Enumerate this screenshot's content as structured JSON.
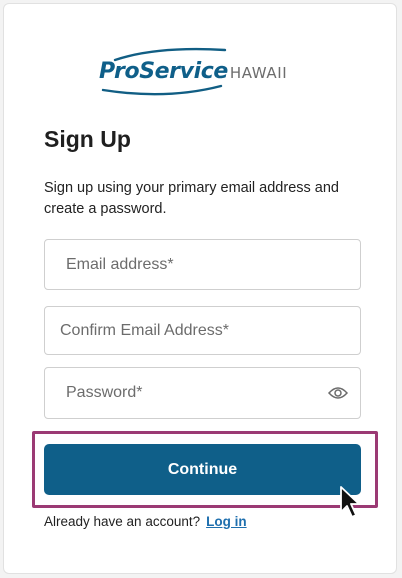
{
  "colors": {
    "brand": "#0f5f89",
    "highlight_border": "#9b3a74",
    "link": "#1e6fae"
  },
  "logo": {
    "brand_primary": "ProService",
    "brand_secondary": "HAWAII"
  },
  "page": {
    "title": "Sign Up",
    "subtitle": "Sign up using your primary email address and create a password."
  },
  "form": {
    "email": {
      "placeholder": "Email address*",
      "value": ""
    },
    "confirm_email": {
      "placeholder": "Confirm Email Address*",
      "value": ""
    },
    "password": {
      "placeholder": "Password*",
      "value": "",
      "toggle_icon": "eye-icon"
    },
    "continue_label": "Continue"
  },
  "footer": {
    "prompt": "Already have an account?",
    "login_label": "Log in"
  },
  "cursor": {
    "icon": "mouse-pointer-icon"
  }
}
